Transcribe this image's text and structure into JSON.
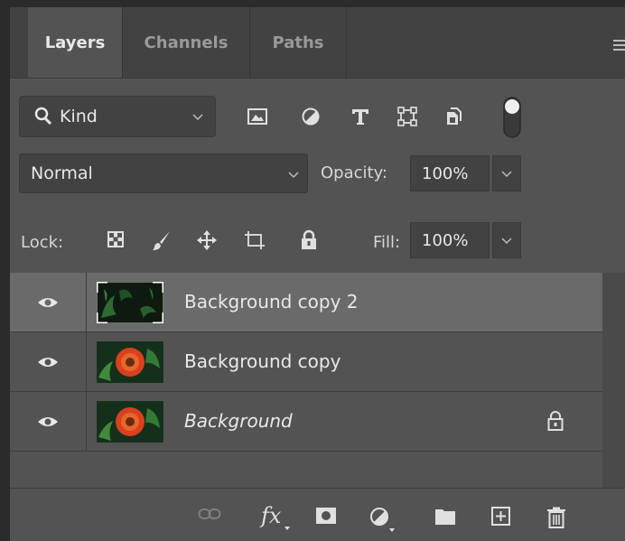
{
  "tabs": [
    {
      "label": "Layers",
      "active": true
    },
    {
      "label": "Channels",
      "active": false
    },
    {
      "label": "Paths",
      "active": false
    }
  ],
  "filter": {
    "kind_label": "Kind",
    "icons": [
      "pixel-layer-filter-icon",
      "adjustment-layer-filter-icon",
      "type-layer-filter-icon",
      "shape-layer-filter-icon",
      "smart-object-filter-icon",
      "filter-toggle-icon"
    ]
  },
  "blend": {
    "mode": "Normal",
    "opacity_label": "Opacity:",
    "opacity_value": "100%"
  },
  "lock": {
    "label": "Lock:",
    "fill_label": "Fill:",
    "fill_value": "100%",
    "icons": [
      "lock-transparent-pixels-icon",
      "lock-image-pixels-icon",
      "lock-position-icon",
      "lock-artboard-icon",
      "lock-all-icon"
    ]
  },
  "layers": [
    {
      "name": "Background copy 2",
      "selected": true,
      "italic": false,
      "locked": false,
      "thumb": "dark-leaves"
    },
    {
      "name": "Background copy",
      "selected": false,
      "italic": false,
      "locked": false,
      "thumb": "flower"
    },
    {
      "name": "Background",
      "selected": false,
      "italic": true,
      "locked": true,
      "thumb": "flower"
    }
  ],
  "bottom_icons": [
    "link-layers-icon",
    "fx-icon",
    "layer-mask-icon",
    "adjustment-layer-icon",
    "group-folder-icon",
    "new-layer-icon",
    "trash-icon"
  ],
  "colors": {
    "panel": "#535353",
    "selected_row": "#6a6a6a",
    "tab_bar": "#424242"
  }
}
